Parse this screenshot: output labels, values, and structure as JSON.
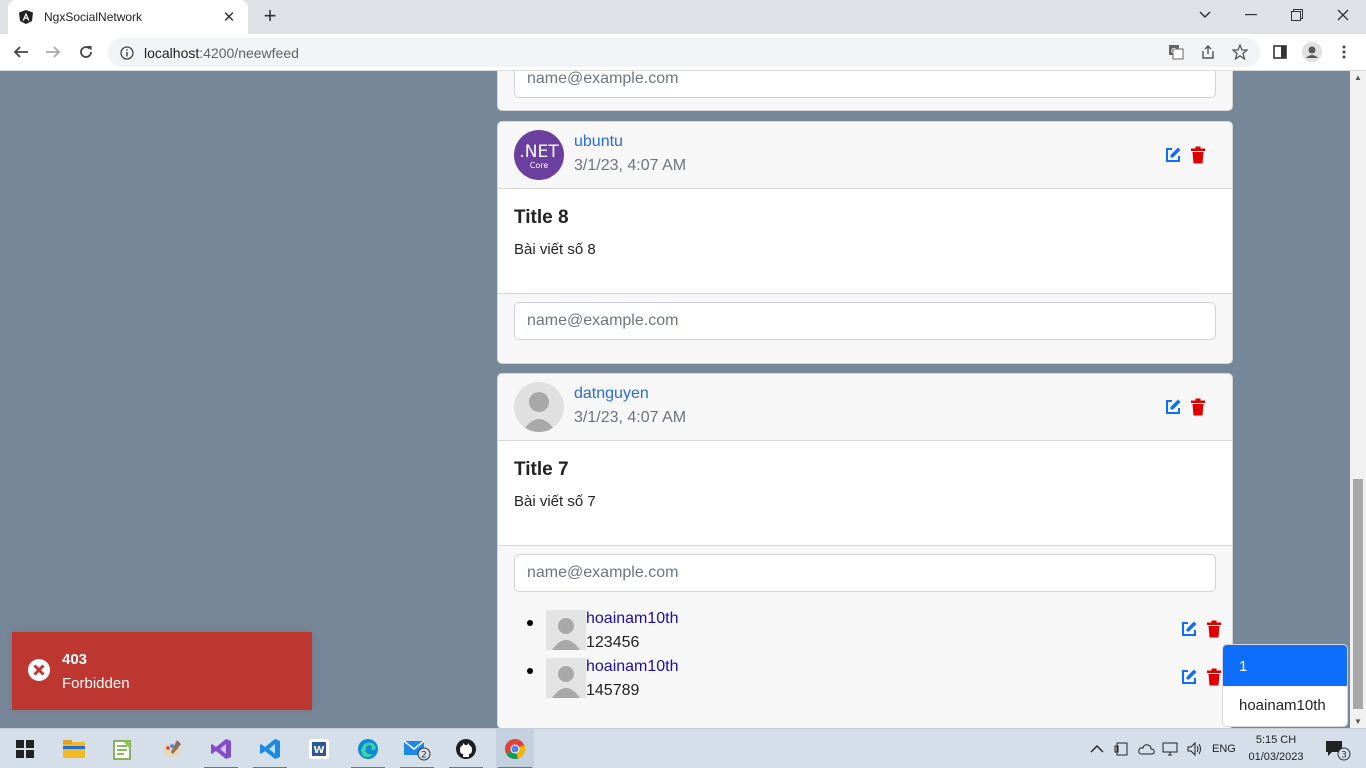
{
  "browser": {
    "tab_title": "NgxSocialNetwork",
    "tab_close": "✕",
    "new_tab": "+",
    "url_host": "localhost",
    "url_path": ":4200/neewfeed"
  },
  "top_comment_input": {
    "placeholder": "name@example.com"
  },
  "posts": [
    {
      "author": "ubuntu",
      "avatar": "dotnet-core-logo",
      "avatar_text": ".NET",
      "avatar_sub": "Core",
      "time": "3/1/23, 4:07 AM",
      "title": "Title 8",
      "content": "Bài viết số 8",
      "comment_placeholder": "name@example.com"
    },
    {
      "author": "datnguyen",
      "avatar": "default-user-avatar",
      "time": "3/1/23, 4:07 AM",
      "title": "Title 7",
      "content": "Bài viết số 7",
      "comment_placeholder": "name@example.com",
      "comments": [
        {
          "user": "hoainam10th",
          "text": "123456"
        },
        {
          "user": "hoainam10th",
          "text": "145789"
        }
      ]
    }
  ],
  "toast": {
    "title": "403",
    "message": "Forbidden",
    "color": "#bd362f"
  },
  "online_popup": {
    "count": "1",
    "user": "hoainam10th"
  },
  "taskbar": {
    "apps": [
      "windows-start",
      "file-explorer",
      "notepad-plus",
      "paint",
      "visual-studio",
      "vscode",
      "word",
      "edge",
      "mail",
      "github-desktop",
      "chrome"
    ],
    "mail_badge": "2",
    "language": "ENG",
    "time": "5:15 CH",
    "date": "01/03/2023",
    "notifications": "3"
  },
  "colors": {
    "accent": "#0d6efd",
    "danger": "#dc0000",
    "link": "#2a6bd4",
    "page_bg": "#77879a"
  }
}
